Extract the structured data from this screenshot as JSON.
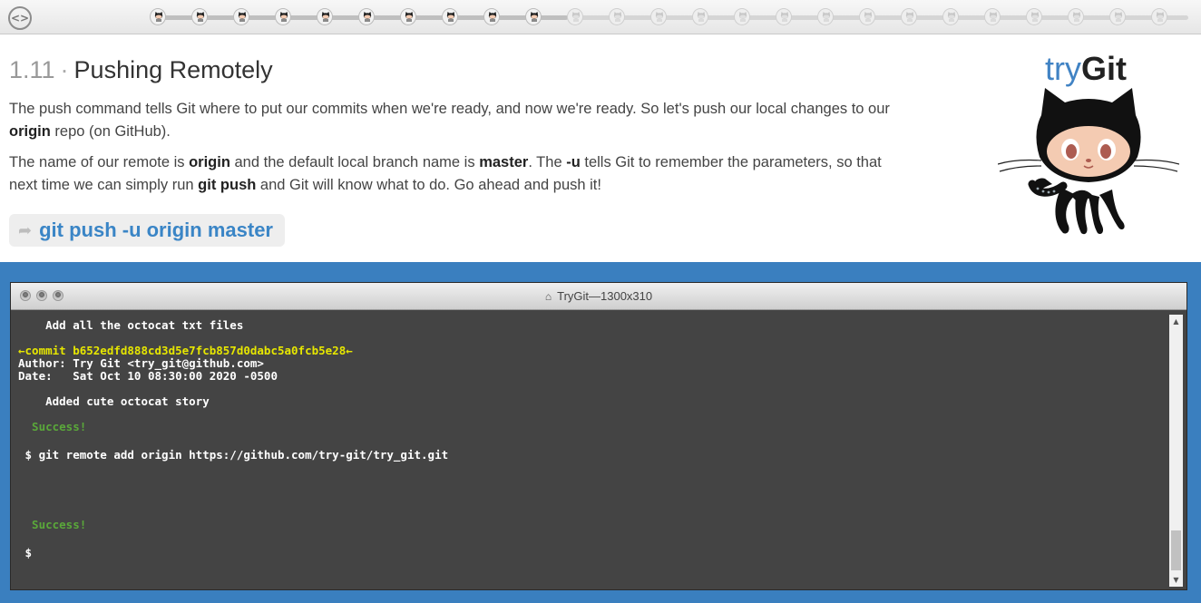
{
  "topbar": {
    "nav_icon": "code-brackets-icon",
    "progress": {
      "completed": 10,
      "total": 25
    }
  },
  "lesson": {
    "number": "1.11",
    "separator": "·",
    "title": "Pushing Remotely",
    "para1": [
      "The push command tells Git where to put our commits when we're ready, and now we're ready. So let's push our local changes to our ",
      "origin",
      " repo (on GitHub)."
    ],
    "para2": [
      "The name of our remote is ",
      "origin",
      " and the default local branch name is ",
      "master",
      ". The ",
      "-u",
      " tells Git to remember the parameters, so that next time we can simply run ",
      "git push",
      " and Git will know what to do. Go ahead and push it!"
    ],
    "command": "git push -u origin master",
    "command_icon": "arrow-right-icon"
  },
  "logo": {
    "try": "try",
    "git": "Git"
  },
  "window": {
    "title": "TryGit—1300x310",
    "title_icon": "home-icon"
  },
  "console": {
    "lines": [
      {
        "text": "    Add all the octocat txt files",
        "kind": "normal"
      },
      {
        "text": "←commit b652edfd888cd3d5e7fcb857d0dabc5a0fcb5e28←",
        "kind": "commit"
      },
      {
        "text": "Author: Try Git <try_git@github.com>",
        "kind": "normal"
      },
      {
        "text": "Date:   Sat Oct 10 08:30:00 2020 -0500",
        "kind": "normal"
      },
      {
        "text": "    Added cute octocat story",
        "kind": "normal"
      },
      {
        "text": "  Success!",
        "kind": "success"
      },
      {
        "text": " $ git remote add origin https://github.com/try-git/try_git.git",
        "kind": "normal"
      },
      {
        "text": "  Success!",
        "kind": "success"
      },
      {
        "text": " $",
        "kind": "normal"
      }
    ]
  },
  "colors": {
    "accent": "#3a85c6",
    "console_bg": "#444444",
    "commit": "#e7e700",
    "success": "#5aa83a",
    "blue_area": "#3a7fbf"
  }
}
